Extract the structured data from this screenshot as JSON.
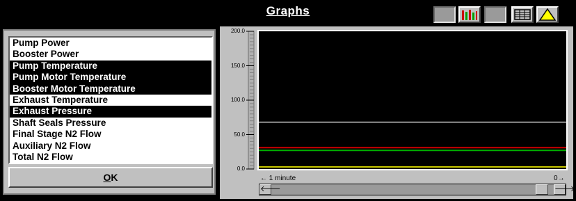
{
  "title": "Graphs",
  "toolbar": {
    "buttons": [
      {
        "icon": "blank-icon"
      },
      {
        "icon": "bar-chart-icon"
      },
      {
        "icon": "blank-icon"
      },
      {
        "icon": "table-view-icon"
      },
      {
        "icon": "warning-bell-icon"
      }
    ]
  },
  "parameters": [
    {
      "label": "Pump Power",
      "selected": false
    },
    {
      "label": "Booster Power",
      "selected": false
    },
    {
      "label": "Pump Temperature",
      "selected": true
    },
    {
      "label": "Pump Motor Temperature",
      "selected": true
    },
    {
      "label": "Booster Motor Temperature",
      "selected": true
    },
    {
      "label": "Exhaust Temperature",
      "selected": false
    },
    {
      "label": "Exhaust Pressure",
      "selected": true
    },
    {
      "label": "Shaft Seals Pressure",
      "selected": false
    },
    {
      "label": "Final Stage N2 Flow",
      "selected": false
    },
    {
      "label": "Auxiliary N2 Flow",
      "selected": false
    },
    {
      "label": "Total N2 Flow",
      "selected": false
    }
  ],
  "ok_button": {
    "mnemonic": "O",
    "rest": "K"
  },
  "chart_data": {
    "type": "line",
    "yticks": [
      "200.0",
      "150.0",
      "100.0",
      "50.0",
      "0.0"
    ],
    "ylim": [
      0,
      200
    ],
    "xlabel_left": "1 minute",
    "xlabel_right": "0",
    "series": [
      {
        "color": "#d0d0d0",
        "values": [
          68,
          68
        ]
      },
      {
        "color": "#cc0000",
        "values": [
          31,
          31
        ]
      },
      {
        "color": "#00b000",
        "values": [
          27,
          27
        ]
      },
      {
        "color": "#c8c800",
        "values": [
          3,
          3
        ]
      }
    ]
  }
}
